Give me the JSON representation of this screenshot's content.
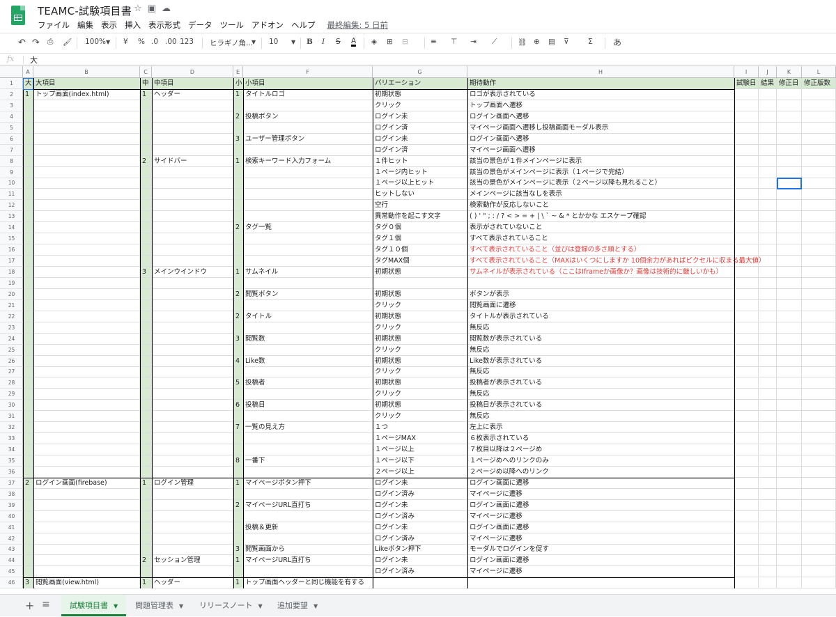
{
  "doc": {
    "title": "TEAMC-試験項目書",
    "last_edit": "最終編集: 5 日前"
  },
  "menu": [
    "ファイル",
    "編集",
    "表示",
    "挿入",
    "表示形式",
    "データ",
    "ツール",
    "アドオン",
    "ヘルプ"
  ],
  "toolbar": {
    "zoom": "100%",
    "currency": "¥",
    "percent": "%",
    "dec_minus": ".0",
    "dec_plus": ".00",
    "format": "123",
    "font": "ヒラギノ角...",
    "size": "10",
    "input": "あ"
  },
  "formula": {
    "fx": "fx",
    "value": "大"
  },
  "columns": [
    "A",
    "B",
    "C",
    "D",
    "E",
    "F",
    "G",
    "H",
    "I",
    "J",
    "K",
    "L"
  ],
  "header_row": [
    "大",
    "大項目",
    "中",
    "中項目",
    "小",
    "小項目",
    "バリエーション",
    "期待動作",
    "試験日",
    "結果",
    "修正日",
    "修正版数"
  ],
  "rows": [
    {
      "n": "2",
      "c": [
        "1",
        "トップ画面(index.html)",
        "1",
        "ヘッダー",
        "1",
        "タイトルロゴ",
        "初期状態",
        "ロゴが表示されている"
      ]
    },
    {
      "n": "3",
      "c": [
        "",
        "",
        "",
        "",
        "",
        "",
        "クリック",
        "トップ画面へ遷移"
      ]
    },
    {
      "n": "4",
      "c": [
        "",
        "",
        "",
        "",
        "2",
        "投稿ボタン",
        "ログイン未",
        "ログイン画面へ遷移"
      ]
    },
    {
      "n": "5",
      "c": [
        "",
        "",
        "",
        "",
        "",
        "",
        "ログイン済",
        "マイページ画面へ遷移し投稿画面モーダル表示"
      ]
    },
    {
      "n": "6",
      "c": [
        "",
        "",
        "",
        "",
        "3",
        "ユーザー管理ボタン",
        "ログイン未",
        "ログイン画面へ遷移"
      ]
    },
    {
      "n": "7",
      "c": [
        "",
        "",
        "",
        "",
        "",
        "",
        "ログイン済",
        "マイページ画面へ遷移"
      ]
    },
    {
      "n": "8",
      "c": [
        "",
        "",
        "2",
        "サイドバー",
        "1",
        "検索キーワード入力フォーム",
        "１件ヒット",
        "該当の景色が１件メインページに表示"
      ]
    },
    {
      "n": "9",
      "c": [
        "",
        "",
        "",
        "",
        "",
        "",
        "１ページ内ヒット",
        "該当の景色がメインページに表示（１ページで完結）"
      ]
    },
    {
      "n": "10",
      "c": [
        "",
        "",
        "",
        "",
        "",
        "",
        "１ページ以上ヒット",
        "該当の景色がメインページに表示（２ページ以降も見れること）"
      ]
    },
    {
      "n": "11",
      "c": [
        "",
        "",
        "",
        "",
        "",
        "",
        "ヒットしない",
        "メインページに該当なしを表示"
      ]
    },
    {
      "n": "12",
      "c": [
        "",
        "",
        "",
        "",
        "",
        "",
        "空行",
        "検索動作が反応しないこと"
      ]
    },
    {
      "n": "13",
      "c": [
        "",
        "",
        "",
        "",
        "",
        "",
        "異常動作を起こす文字",
        "( ) ' \" ; : / ? < > = + | \\ ` ~ & * とかかな エスケープ確認"
      ]
    },
    {
      "n": "14",
      "c": [
        "",
        "",
        "",
        "",
        "2",
        "タグ一覧",
        "タグ０個",
        "表示がされていないこと"
      ]
    },
    {
      "n": "15",
      "c": [
        "",
        "",
        "",
        "",
        "",
        "",
        "タグ１個",
        "すべて表示されていること"
      ]
    },
    {
      "n": "16",
      "c": [
        "",
        "",
        "",
        "",
        "",
        "",
        "タグ１０個",
        "すべて表示されていること（並びは登録の多さ順とする）"
      ],
      "red": true
    },
    {
      "n": "17",
      "c": [
        "",
        "",
        "",
        "",
        "",
        "",
        "タグMAX個",
        "すべて表示されていること（MAXはいくつにしますか 10個余力があればピクセルに収まる最大値）"
      ],
      "red": true
    },
    {
      "n": "18",
      "c": [
        "",
        "",
        "3",
        "メインウインドウ",
        "1",
        "サムネイル",
        "初期状態",
        "サムネイルが表示されている（ここはIframeか画像か？画像は技術的に厳しいかも）"
      ],
      "red": true
    },
    {
      "n": "19",
      "c": [
        "",
        "",
        "",
        "",
        "",
        "",
        "",
        ""
      ]
    },
    {
      "n": "20",
      "c": [
        "",
        "",
        "",
        "",
        "2",
        "閲覧ボタン",
        "初期状態",
        "ボタンが表示"
      ]
    },
    {
      "n": "21",
      "c": [
        "",
        "",
        "",
        "",
        "",
        "",
        "クリック",
        "閲覧画面に遷移"
      ]
    },
    {
      "n": "22",
      "c": [
        "",
        "",
        "",
        "",
        "2",
        "タイトル",
        "初期状態",
        "タイトルが表示されている"
      ]
    },
    {
      "n": "23",
      "c": [
        "",
        "",
        "",
        "",
        "",
        "",
        "クリック",
        "無反応"
      ]
    },
    {
      "n": "24",
      "c": [
        "",
        "",
        "",
        "",
        "3",
        "閲覧数",
        "初期状態",
        "閲覧数が表示されている"
      ]
    },
    {
      "n": "25",
      "c": [
        "",
        "",
        "",
        "",
        "",
        "",
        "クリック",
        "無反応"
      ]
    },
    {
      "n": "26",
      "c": [
        "",
        "",
        "",
        "",
        "4",
        "Like数",
        "初期状態",
        "Like数が表示されている"
      ]
    },
    {
      "n": "27",
      "c": [
        "",
        "",
        "",
        "",
        "",
        "",
        "クリック",
        "無反応"
      ]
    },
    {
      "n": "28",
      "c": [
        "",
        "",
        "",
        "",
        "5",
        "投稿者",
        "初期状態",
        "投稿者が表示されている"
      ]
    },
    {
      "n": "29",
      "c": [
        "",
        "",
        "",
        "",
        "",
        "",
        "クリック",
        "無反応"
      ]
    },
    {
      "n": "30",
      "c": [
        "",
        "",
        "",
        "",
        "6",
        "投稿日",
        "初期状態",
        "投稿日が表示されている"
      ]
    },
    {
      "n": "31",
      "c": [
        "",
        "",
        "",
        "",
        "",
        "",
        "クリック",
        "無反応"
      ]
    },
    {
      "n": "32",
      "c": [
        "",
        "",
        "",
        "",
        "7",
        "一覧の見え方",
        "１つ",
        "左上に表示"
      ]
    },
    {
      "n": "33",
      "c": [
        "",
        "",
        "",
        "",
        "",
        "",
        "１ページMAX",
        "６枚表示されている"
      ]
    },
    {
      "n": "34",
      "c": [
        "",
        "",
        "",
        "",
        "",
        "",
        "１ページ以上",
        "７枚目以降は２ページめ"
      ]
    },
    {
      "n": "35",
      "c": [
        "",
        "",
        "",
        "",
        "8",
        "一番下",
        "１ページ以下",
        "１ページめへのリンクのみ"
      ]
    },
    {
      "n": "36",
      "c": [
        "",
        "",
        "",
        "",
        "",
        "",
        "２ページ以上",
        "２ページめ以降へのリンク"
      ]
    },
    {
      "n": "37",
      "c": [
        "2",
        "ログイン画面(firebase)",
        "1",
        "ログイン管理",
        "1",
        "マイページボタン押下",
        "ログイン未",
        "ログイン画面に遷移"
      ]
    },
    {
      "n": "38",
      "c": [
        "",
        "",
        "",
        "",
        "",
        "",
        "ログイン済み",
        "マイページに遷移"
      ]
    },
    {
      "n": "39",
      "c": [
        "",
        "",
        "",
        "",
        "2",
        "マイページURL直打ち",
        "ログイン未",
        "ログイン画面に遷移"
      ]
    },
    {
      "n": "40",
      "c": [
        "",
        "",
        "",
        "",
        "",
        "",
        "ログイン済み",
        "マイページに遷移"
      ]
    },
    {
      "n": "41",
      "c": [
        "",
        "",
        "",
        "",
        "",
        "投稿＆更新",
        "ログイン未",
        "ログイン画面に遷移"
      ]
    },
    {
      "n": "42",
      "c": [
        "",
        "",
        "",
        "",
        "",
        "",
        "ログイン済み",
        "マイページに遷移"
      ]
    },
    {
      "n": "43",
      "c": [
        "",
        "",
        "",
        "",
        "3",
        "閲覧画面から",
        "Likeボタン押下",
        "モーダルでログインを促す"
      ]
    },
    {
      "n": "44",
      "c": [
        "",
        "",
        "2",
        "セッション管理",
        "1",
        "マイページURL直打ち",
        "ログイン未",
        "ログイン画面に遷移"
      ]
    },
    {
      "n": "45",
      "c": [
        "",
        "",
        "",
        "",
        "",
        "",
        "ログイン済み",
        "マイページに遷移"
      ]
    },
    {
      "n": "46",
      "c": [
        "3",
        "閲覧画面(view.html)",
        "1",
        "ヘッダー",
        "1",
        "トップ画面ヘッダーと同じ機能を有する",
        "",
        ""
      ]
    }
  ],
  "tabs": [
    "試験項目書",
    "問題管理表",
    "リリースノート",
    "追加要望"
  ],
  "colors": {
    "header_green": "#d9ead3",
    "accent": "#188038",
    "warn": "#e53935"
  }
}
